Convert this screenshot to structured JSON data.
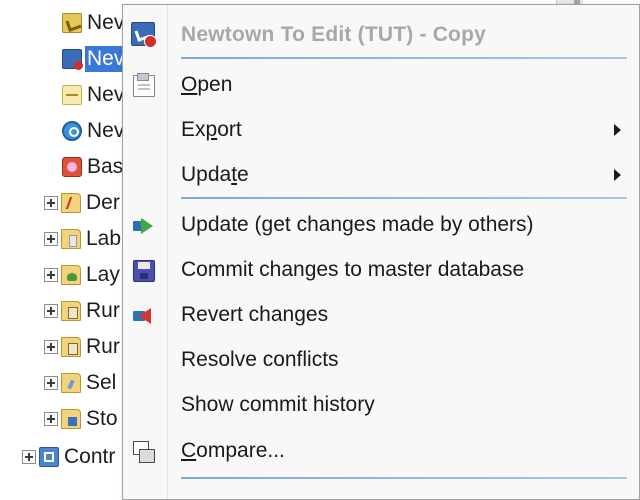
{
  "tree": {
    "items": [
      {
        "label": "Nev",
        "icon": "database-icon"
      },
      {
        "label": "Nev",
        "icon": "edit-version-icon",
        "selected": true
      },
      {
        "label": "Nev",
        "icon": "map-icon"
      },
      {
        "label": "Nev",
        "icon": "search-icon"
      },
      {
        "label": "Bas",
        "icon": "base-icon"
      },
      {
        "label": "Der",
        "icon": "folder-icon"
      },
      {
        "label": "Lab",
        "icon": "folder-icon"
      },
      {
        "label": "Lay",
        "icon": "folder-icon"
      },
      {
        "label": "Rur",
        "icon": "folder-icon"
      },
      {
        "label": "Rur",
        "icon": "folder-icon"
      },
      {
        "label": "Sel",
        "icon": "folder-icon"
      },
      {
        "label": "Sto",
        "icon": "folder-icon"
      },
      {
        "label": "Contr",
        "icon": "control-icon"
      }
    ]
  },
  "menu": {
    "header": {
      "title": "Newtown To Edit (TUT) - Copy",
      "icon": "edit-version-icon"
    },
    "items": {
      "open": {
        "label_pre": "",
        "label_u": "O",
        "label_post": "pen",
        "icon": "open-icon"
      },
      "export": {
        "label_pre": "Ex",
        "label_u": "p",
        "label_post": "ort"
      },
      "update_sub": {
        "label_pre": "Upda",
        "label_u": "t",
        "label_post": "e"
      },
      "update_changes": {
        "label": "Update (get changes made by others)",
        "icon": "update-icon"
      },
      "commit": {
        "label": "Commit changes to master database",
        "icon": "commit-icon"
      },
      "revert": {
        "label": "Revert changes",
        "icon": "revert-icon"
      },
      "resolve": {
        "label": "Resolve conflicts"
      },
      "history": {
        "label": "Show commit history"
      },
      "compare": {
        "label_pre": "",
        "label_u": "C",
        "label_post": "ompare...",
        "icon": "compare-icon"
      }
    }
  },
  "colors": {
    "selection": "#3a78d8",
    "separator": "#7fa9d9",
    "header_text": "#a8a8a8"
  }
}
